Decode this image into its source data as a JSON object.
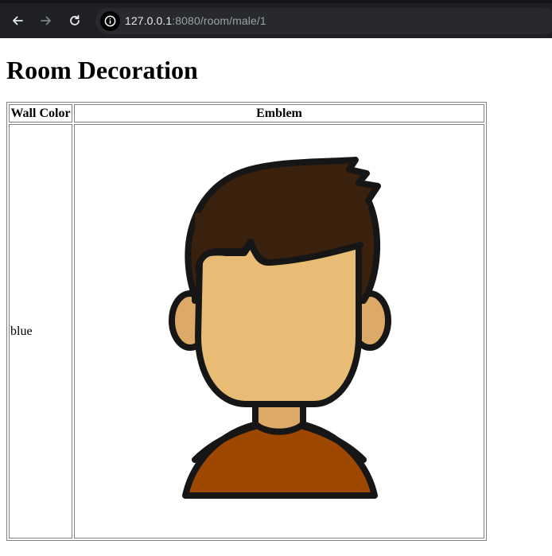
{
  "browser": {
    "url_host": "127.0.0.1",
    "url_rest": ":8080/room/male/1"
  },
  "page": {
    "title": "Room Decoration",
    "table": {
      "headers": [
        "Wall Color",
        "Emblem"
      ],
      "rows": [
        {
          "wall_color": "blue",
          "emblem": "male-avatar"
        }
      ]
    }
  },
  "colors": {
    "hair": "#3a210d",
    "skin": "#e8bc74",
    "skin_shadow": "#dca966",
    "shirt": "#9e4700",
    "outline": "#161616"
  }
}
